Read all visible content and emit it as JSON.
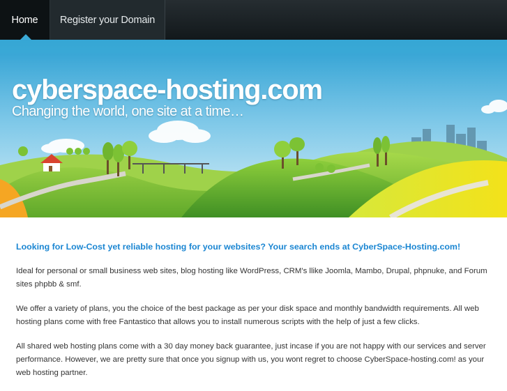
{
  "nav": {
    "items": [
      {
        "label": "Home",
        "active": true
      },
      {
        "label": "Register your Domain",
        "active": false
      }
    ],
    "active_indicator_color": "#3aa9d6"
  },
  "banner": {
    "title": "cyberspace-hosting.com",
    "tagline": "Changing the world, one site at a time…",
    "sky_color": "#3aa9d6",
    "hill_color": "#8cc63f"
  },
  "content": {
    "headline": "Looking for Low-Cost yet reliable hosting for your websites? Your search ends at CyberSpace-Hosting.com!",
    "paragraphs": [
      "Ideal for personal or small business web sites, blog hosting like WordPress, CRM's llike Joomla, Mambo, Drupal, phpnuke, and Forum sites phpbb & smf.",
      "We offer a variety of plans, you the choice of the best package as per your disk space and monthly bandwidth requirements. All web hosting plans come with free Fantastico that allows you to install numerous scripts with the help of just a few clicks.",
      "All shared web hosting plans come with a 30 day money back guarantee, just incase if you are not happy with our services and server performance. However, we are pretty sure that once you signup with us, you wont regret to choose CyberSpace-hosting.com! as your web hosting partner."
    ],
    "headline_color": "#1b86d2"
  }
}
